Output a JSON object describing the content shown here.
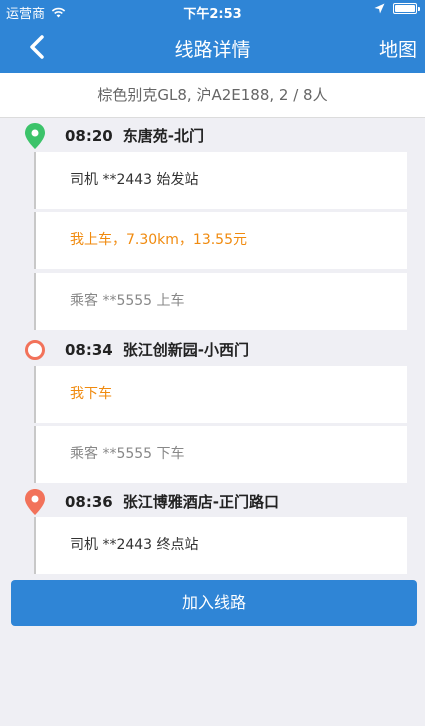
{
  "statusbar": {
    "carrier": "运营商",
    "time": "下午2:53"
  },
  "navbar": {
    "title": "线路详情",
    "right_action": "地图"
  },
  "vehicle_info": "棕色别克GL8, 沪A2E188, 2 / 8人",
  "stops": [
    {
      "time": "08:20",
      "name": "东唐苑-北门",
      "icon": "map-pin-icon",
      "color": "#3cc36a"
    },
    {
      "time": "08:34",
      "name": "张江创新园-小西门",
      "icon": "circle-ring-icon",
      "color": "#f2725a"
    },
    {
      "time": "08:36",
      "name": "张江博雅酒店-正门路口",
      "icon": "map-pin-icon",
      "color": "#f2725a"
    }
  ],
  "events": [
    {
      "text": "司机 **2443 始发站",
      "style": "dark"
    },
    {
      "text": "我上车，7.30km，13.55元",
      "style": "orange"
    },
    {
      "text": "乘客 **5555 上车",
      "style": "gray"
    },
    {
      "text": "我下车",
      "style": "orange"
    },
    {
      "text": "乘客 **5555 下车",
      "style": "gray"
    },
    {
      "text": "司机 **2443 终点站",
      "style": "dark"
    }
  ],
  "join_button": "加入线路",
  "colors": {
    "primary": "#2f85d6",
    "orange": "#f08a0e",
    "green": "#3cc36a",
    "red": "#f2725a"
  }
}
